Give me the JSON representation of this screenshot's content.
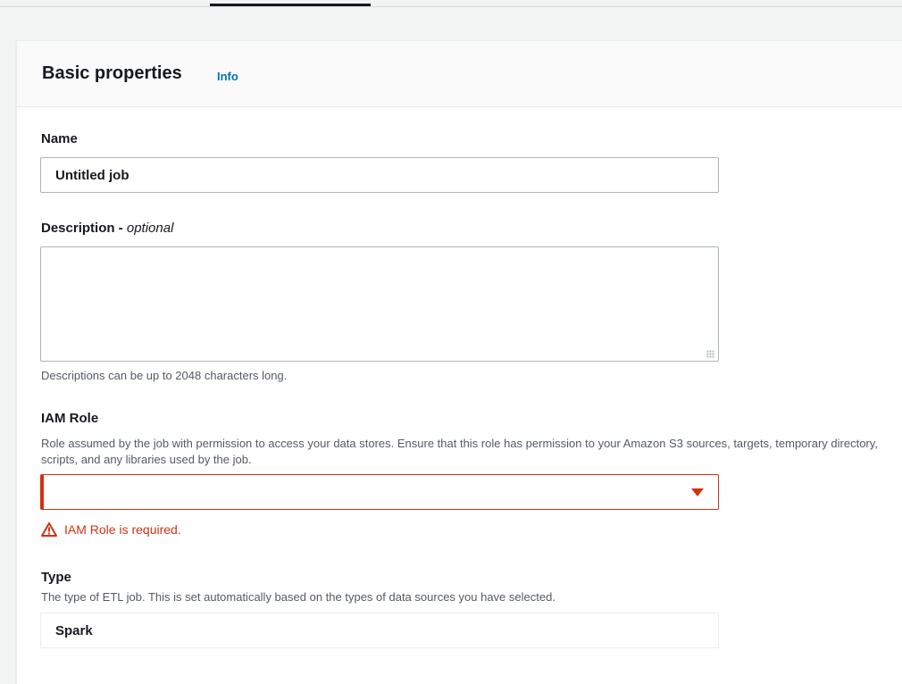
{
  "header": {
    "title": "Basic properties",
    "info_link": "Info"
  },
  "name": {
    "label": "Name",
    "value": "Untitled job"
  },
  "description": {
    "label": "Description - ",
    "label_optional": "optional",
    "value": "",
    "constraint": "Descriptions can be up to 2048 characters long."
  },
  "iam_role": {
    "label": "IAM Role",
    "description": "Role assumed by the job with permission to access your data stores. Ensure that this role has permission to your Amazon S3 sources, targets, temporary directory, scripts, and any libraries used by the job.",
    "selected": "",
    "error": "IAM Role is required.",
    "icons": {
      "caret": "caret-down-icon",
      "warning": "warning-icon"
    }
  },
  "type": {
    "label": "Type",
    "description": "The type of ETL job. This is set automatically based on the types of data sources you have selected.",
    "value": "Spark"
  },
  "colors": {
    "link": "#0073bb",
    "error": "#d13212",
    "text": "#16191f",
    "secondary_text": "#545b64"
  }
}
